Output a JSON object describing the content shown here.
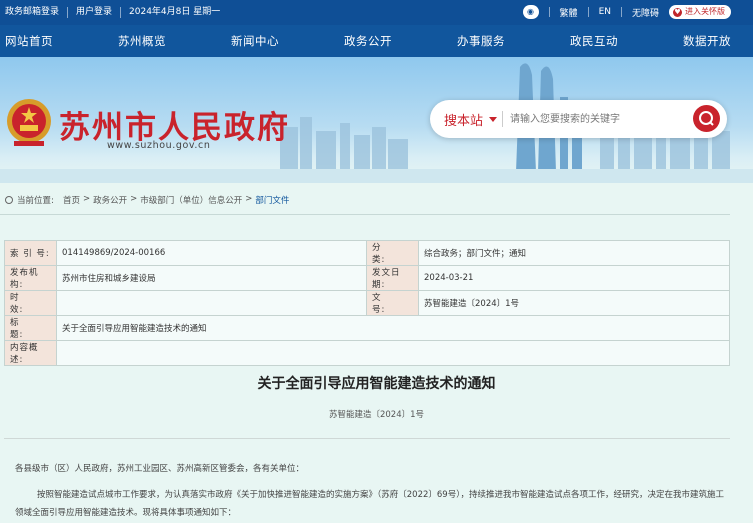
{
  "topbar": {
    "links": [
      "政务邮箱登录",
      "用户登录",
      "2024年4月8日 星期一"
    ],
    "right": {
      "traditional": "繁體",
      "english": "EN",
      "accessible": "无障碍",
      "care_mode": "进入关怀版"
    }
  },
  "nav": [
    "网站首页",
    "苏州概览",
    "新闻中心",
    "政务公开",
    "办事服务",
    "政民互动",
    "数据开放"
  ],
  "header": {
    "site_title": "苏州市人民政府",
    "site_url": "www.suzhou.gov.cn"
  },
  "search": {
    "label": "搜本站",
    "placeholder": "请输入您要搜索的关键字"
  },
  "breadcrumb": {
    "prefix": "当前位置:",
    "items": [
      "首页",
      "政务公开",
      "市级部门（单位）信息公开",
      "部门文件"
    ],
    "sep": ">"
  },
  "meta": {
    "index_label": "索 引 号:",
    "index_value": "014149869/2024-00166",
    "category_label": "分　　类:",
    "category_value": "综合政务；部门文件；通知",
    "issuer_label": "发布机构:",
    "issuer_value": "苏州市住房和城乡建设局",
    "date_label": "发文日期:",
    "date_value": "2024-03-21",
    "validity_label": "时　　效:",
    "validity_value": "",
    "docnum_label": "文　　号:",
    "docnum_value": "苏智能建造〔2024〕1号",
    "title_label": "标　　题:",
    "title_value": "关于全面引导应用智能建造技术的通知",
    "summary_label": "内容概述:",
    "summary_value": ""
  },
  "article": {
    "title": "关于全面引导应用智能建造技术的通知",
    "docno": "苏智能建造〔2024〕1号",
    "p1": "各县级市（区）人民政府，苏州工业园区、苏州高新区管委会，各有关单位：",
    "p2": "按照智能建造试点城市工作要求，为认真落实市政府《关于加快推进智能建造的实施方案》（苏府〔2022〕69号），持续推进我市智能建造试点各项工作，经研究，决定在我市建筑施工领域全面引导应用智能建造技术。现将具体事项通知如下："
  },
  "colors": {
    "nav_blue": "#11569d",
    "top_blue": "#0f4f96",
    "brand_red": "#c9232c",
    "page_bg": "#e8f6f3"
  }
}
